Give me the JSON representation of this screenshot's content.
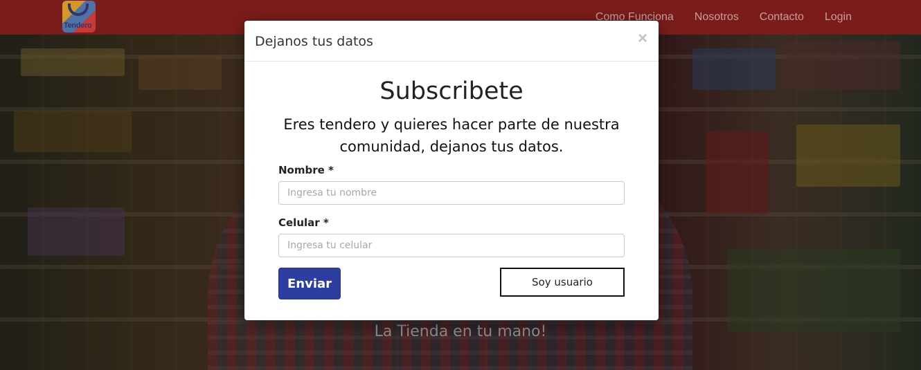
{
  "navbar": {
    "logo_text": "Tendero",
    "links": [
      "Como Funciona",
      "Nosotros",
      "Contacto",
      "Login"
    ],
    "background": "#7a1d1a"
  },
  "hero": {
    "tagline": "La Tienda en tu mano!"
  },
  "modal": {
    "title": "Dejanos tus datos",
    "close_label": "×",
    "heading": "Subscribete",
    "text": "Eres tendero y quieres hacer parte de nuestra comunidad, dejanos tus datos.",
    "fields": {
      "name": {
        "label": "Nombre *",
        "placeholder": "Ingresa tu nombre",
        "value": ""
      },
      "phone": {
        "label": "Celular *",
        "placeholder": "Ingresa tu celular",
        "value": ""
      }
    },
    "submit_label": "Enviar",
    "user_label": "Soy usuario",
    "submit_color": "#2d3ea0"
  }
}
